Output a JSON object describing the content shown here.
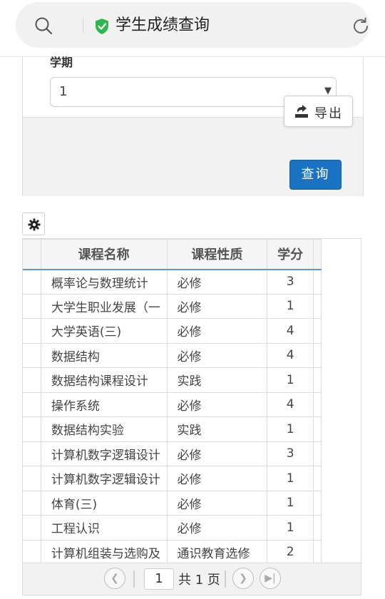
{
  "browser": {
    "title": "学生成绩查询"
  },
  "form": {
    "term_label": "学期",
    "term_value": "1",
    "export_label": "导出",
    "query_label": "查询"
  },
  "table": {
    "headers": [
      "课程名称",
      "课程性质",
      "学分"
    ],
    "rows": [
      {
        "name": "概率论与数理统计",
        "type": "必修",
        "credit": "3"
      },
      {
        "name": "大学生职业发展（一",
        "type": "必修",
        "credit": "1"
      },
      {
        "name": "大学英语(三)",
        "type": "必修",
        "credit": "4"
      },
      {
        "name": "数据结构",
        "type": "必修",
        "credit": "4"
      },
      {
        "name": "数据结构课程设计",
        "type": "实践",
        "credit": "1"
      },
      {
        "name": "操作系统",
        "type": "必修",
        "credit": "4"
      },
      {
        "name": "数据结构实验",
        "type": "实践",
        "credit": "1"
      },
      {
        "name": "计算机数字逻辑设计",
        "type": "必修",
        "credit": "3"
      },
      {
        "name": "计算机数字逻辑设计",
        "type": "必修",
        "credit": "1"
      },
      {
        "name": "体育(三)",
        "type": "必修",
        "credit": "1"
      },
      {
        "name": "工程认识",
        "type": "必修",
        "credit": "1"
      },
      {
        "name": "计算机组装与选购及",
        "type": "通识教育选修",
        "credit": "2"
      }
    ]
  },
  "pager": {
    "page": "1",
    "total_text": "共 1 页"
  },
  "colors": {
    "primary": "#1a73c2",
    "header_underline": "#5b9bd5",
    "shield": "#2db84d"
  }
}
